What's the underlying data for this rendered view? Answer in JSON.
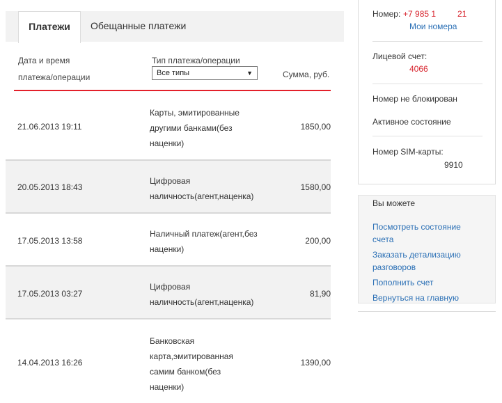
{
  "tabs": {
    "payments": "Платежи",
    "promised": "Обещанные платежи"
  },
  "table": {
    "header_date_line1": "Дата и время",
    "header_date_line2": "платежа/операции",
    "header_type": "Тип платежа/операции",
    "header_sum": "Сумма, руб.",
    "type_filter_value": "Все типы",
    "rows": [
      {
        "datetime": "21.06.2013 19:11",
        "type_lines": [
          "Карты, эмитированные",
          "другими банками(без",
          "наценки)"
        ],
        "amount": "1850,00"
      },
      {
        "datetime": "20.05.2013 18:43",
        "type_lines": [
          "Цифровая",
          "наличность(агент,наценка)"
        ],
        "amount": "1580,00"
      },
      {
        "datetime": "17.05.2013 13:58",
        "type_lines": [
          "Наличный платеж(агент,без",
          "наценки)"
        ],
        "amount": "200,00"
      },
      {
        "datetime": "17.05.2013 03:27",
        "type_lines": [
          "Цифровая",
          "наличность(агент,наценка)"
        ],
        "amount": "81,90"
      },
      {
        "datetime": "14.04.2013 16:26",
        "type_lines": [
          "Банковская",
          "карта,эмитированная",
          "самим банком(без",
          "наценки)"
        ],
        "amount": "1390,00"
      }
    ]
  },
  "account": {
    "number_label": "Номер:",
    "number_value": "+7 985 1",
    "number_suffix": "21",
    "my_numbers_link": "Мои номера",
    "personal_account_label": "Лицевой счет:",
    "personal_account_value": "4066",
    "status_blocked": "Номер не блокирован",
    "status_active": "Активное состояние",
    "sim_label": "Номер SIM-карты:",
    "sim_value": "9910"
  },
  "actions": {
    "title": "Вы можете",
    "view_balance_line1": "Посмотреть состояние",
    "view_balance_line2": "счета",
    "order_details_line1": "Заказать детализацию",
    "order_details_line2": "разговоров",
    "top_up": "Пополнить счет",
    "go_home": "Вернуться на главную"
  },
  "colors": {
    "accent_red": "#e3202a",
    "link_blue": "#2a6fb5",
    "shaded_row": "#f2f2f2"
  }
}
